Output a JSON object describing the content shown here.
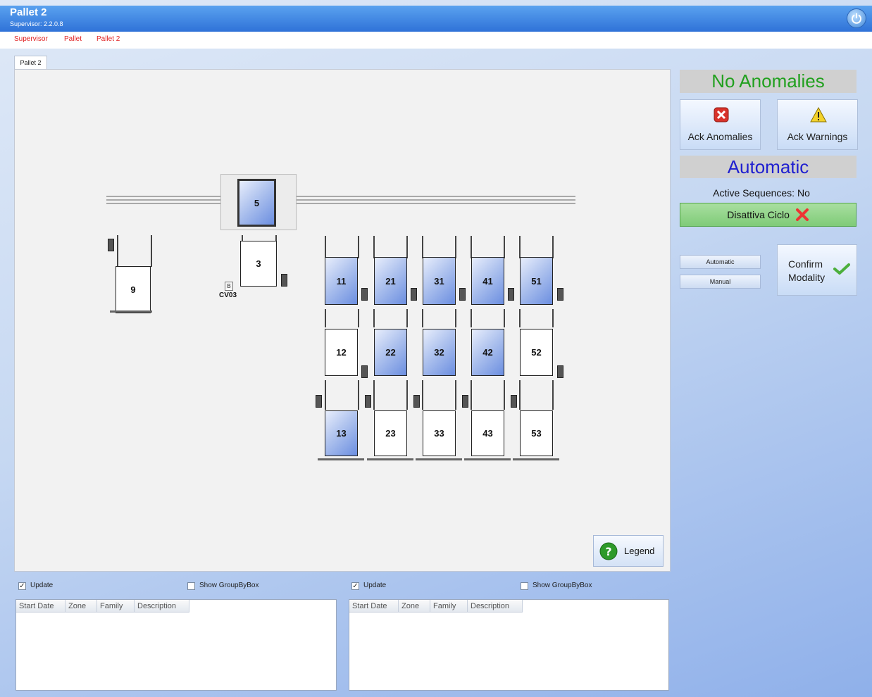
{
  "window": {
    "title": "Pallet 2",
    "version": "Supervisor: 2.2.0.8"
  },
  "breadcrumb": [
    "Supervisor",
    "Pallet",
    "Pallet 2"
  ],
  "tab": {
    "label": "Pallet 2"
  },
  "layout": {
    "stations": [
      {
        "id": "5",
        "state": "occupied"
      },
      {
        "id": "3",
        "state": "empty"
      },
      {
        "id": "9",
        "state": "empty"
      },
      {
        "id": "11",
        "state": "occupied"
      },
      {
        "id": "21",
        "state": "occupied"
      },
      {
        "id": "31",
        "state": "occupied"
      },
      {
        "id": "41",
        "state": "occupied"
      },
      {
        "id": "51",
        "state": "occupied"
      },
      {
        "id": "12",
        "state": "empty"
      },
      {
        "id": "22",
        "state": "occupied"
      },
      {
        "id": "32",
        "state": "occupied"
      },
      {
        "id": "42",
        "state": "occupied"
      },
      {
        "id": "52",
        "state": "empty"
      },
      {
        "id": "13",
        "state": "occupied"
      },
      {
        "id": "23",
        "state": "empty"
      },
      {
        "id": "33",
        "state": "empty"
      },
      {
        "id": "43",
        "state": "empty"
      },
      {
        "id": "53",
        "state": "empty"
      }
    ],
    "cv_marker": {
      "letter": "B",
      "label": "CV03"
    }
  },
  "legend_button": {
    "label": "Legend"
  },
  "right_panel": {
    "anomaly_status": "No Anomalies",
    "ack_anomalies": "Ack Anomalies",
    "ack_warnings": "Ack Warnings",
    "mode_status": "Automatic",
    "active_sequences_label": "Active Sequences:",
    "active_sequences_value": "No",
    "disattiva_label": "Disattiva Ciclo",
    "mode_automatic": "Automatic",
    "mode_manual": "Manual",
    "confirm_line1": "Confirm",
    "confirm_line2": "Modality"
  },
  "bottom": {
    "left": {
      "update_label": "Update",
      "update_checked": true,
      "group_label": "Show GroupByBox",
      "group_checked": false,
      "columns": [
        "Start Date",
        "Zone",
        "Family",
        "Description"
      ]
    },
    "right": {
      "update_label": "Update",
      "update_checked": true,
      "group_label": "Show GroupByBox",
      "group_checked": false,
      "columns": [
        "Start Date",
        "Zone",
        "Family",
        "Description"
      ]
    }
  },
  "colors": {
    "occupied": "#8fa8e8",
    "empty": "#ffffff",
    "ok_green": "#21a01e",
    "mode_blue": "#2020d0",
    "crumb_red": "#e02020"
  }
}
